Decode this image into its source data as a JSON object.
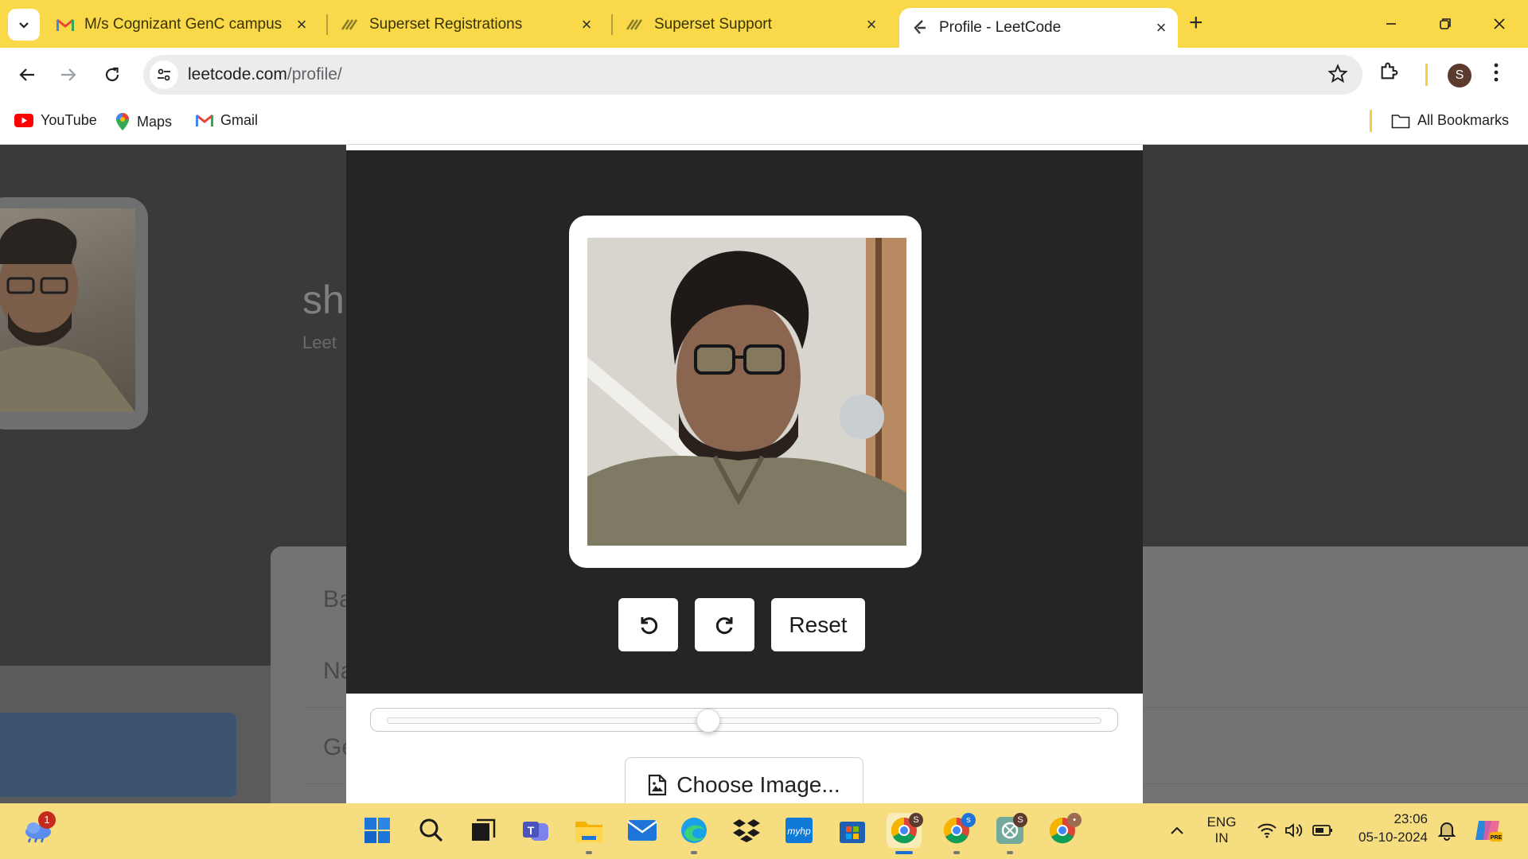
{
  "browser": {
    "tabs": [
      {
        "title": "M/s Cognizant GenC campus hi",
        "favicon": "gmail-icon",
        "active": false
      },
      {
        "title": "Superset Registrations",
        "favicon": "superset-icon",
        "active": false
      },
      {
        "title": "Superset Support",
        "favicon": "superset-icon",
        "active": false
      },
      {
        "title": "Profile - LeetCode",
        "favicon": "leetcode-icon",
        "active": true
      }
    ],
    "new_tab_label": "+",
    "url_domain": "leetcode.com",
    "url_path": "/profile/",
    "profile_initial": "S",
    "bookmarks": [
      {
        "label": "YouTube",
        "icon": "youtube-icon"
      },
      {
        "label": "Maps",
        "icon": "maps-icon"
      },
      {
        "label": "Gmail",
        "icon": "gmail-icon"
      }
    ],
    "all_bookmarks_label": "All Bookmarks",
    "colors": {
      "tab_strip": "#f9d94a",
      "taskbar": "#f6dd80"
    }
  },
  "page_background": {
    "name_partial": "sh",
    "sub_partial": "Leet",
    "section_partial": "Ba",
    "field1_partial": "Na",
    "field2_partial": "Ge"
  },
  "modal": {
    "buttons": {
      "rotate_left": "rotate-left-icon",
      "rotate_right": "rotate-right-icon",
      "reset_label": "Reset"
    },
    "zoom_level": 0.45,
    "choose_image_label": "Choose Image..."
  },
  "taskbar": {
    "weather_badge": "1",
    "language_line1": "ENG",
    "language_line2": "IN",
    "time": "23:06",
    "date": "05-10-2024",
    "apps": [
      "start-icon",
      "search-icon",
      "task-view-icon",
      "teams-icon",
      "file-explorer-icon",
      "mail-icon",
      "edge-icon",
      "dropbox-icon",
      "myhp-icon",
      "store-icon",
      "chrome-icon",
      "chrome-icon",
      "chatgpt-icon",
      "chrome-icon"
    ]
  }
}
